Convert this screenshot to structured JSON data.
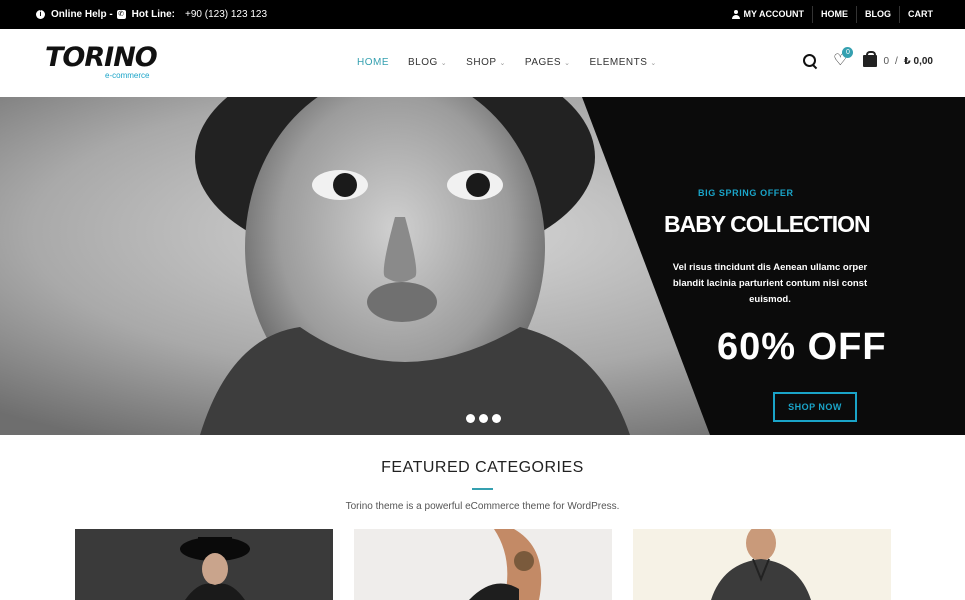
{
  "topbar": {
    "help": "Online Help -",
    "hotline_label": "Hot Line:",
    "phone": "+90 (123) 123 123",
    "links": [
      "MY ACCOUNT",
      "HOME",
      "BLOG",
      "CART"
    ]
  },
  "header": {
    "logo_main": "TORINO",
    "logo_sub": "e-commerce",
    "nav": [
      {
        "label": "HOME",
        "has_caret": false
      },
      {
        "label": "BLOG",
        "has_caret": true
      },
      {
        "label": "SHOP",
        "has_caret": true
      },
      {
        "label": "PAGES",
        "has_caret": true
      },
      {
        "label": "ELEMENTS",
        "has_caret": true
      }
    ],
    "wishlist_count": "0",
    "cart_count": "0",
    "cart_sep": "/",
    "cart_amount": "₺ 0,00"
  },
  "hero": {
    "offer": "BIG SPRING OFFER",
    "title": "BABY COLLECTION",
    "description": "Vel risus tincidunt dis Aenean ullamc orper blandit lacinia parturient contum nisi const euismod.",
    "discount": "60% OFF",
    "button": "SHOP NOW"
  },
  "featured": {
    "title": "FEATURED CATEGORIES",
    "subtitle": "Torino theme is a powerful eCommerce theme for WordPress."
  },
  "colors": {
    "accent": "#35a0b0",
    "accent_alt": "#1aa4c8",
    "topbar": "#000000"
  }
}
